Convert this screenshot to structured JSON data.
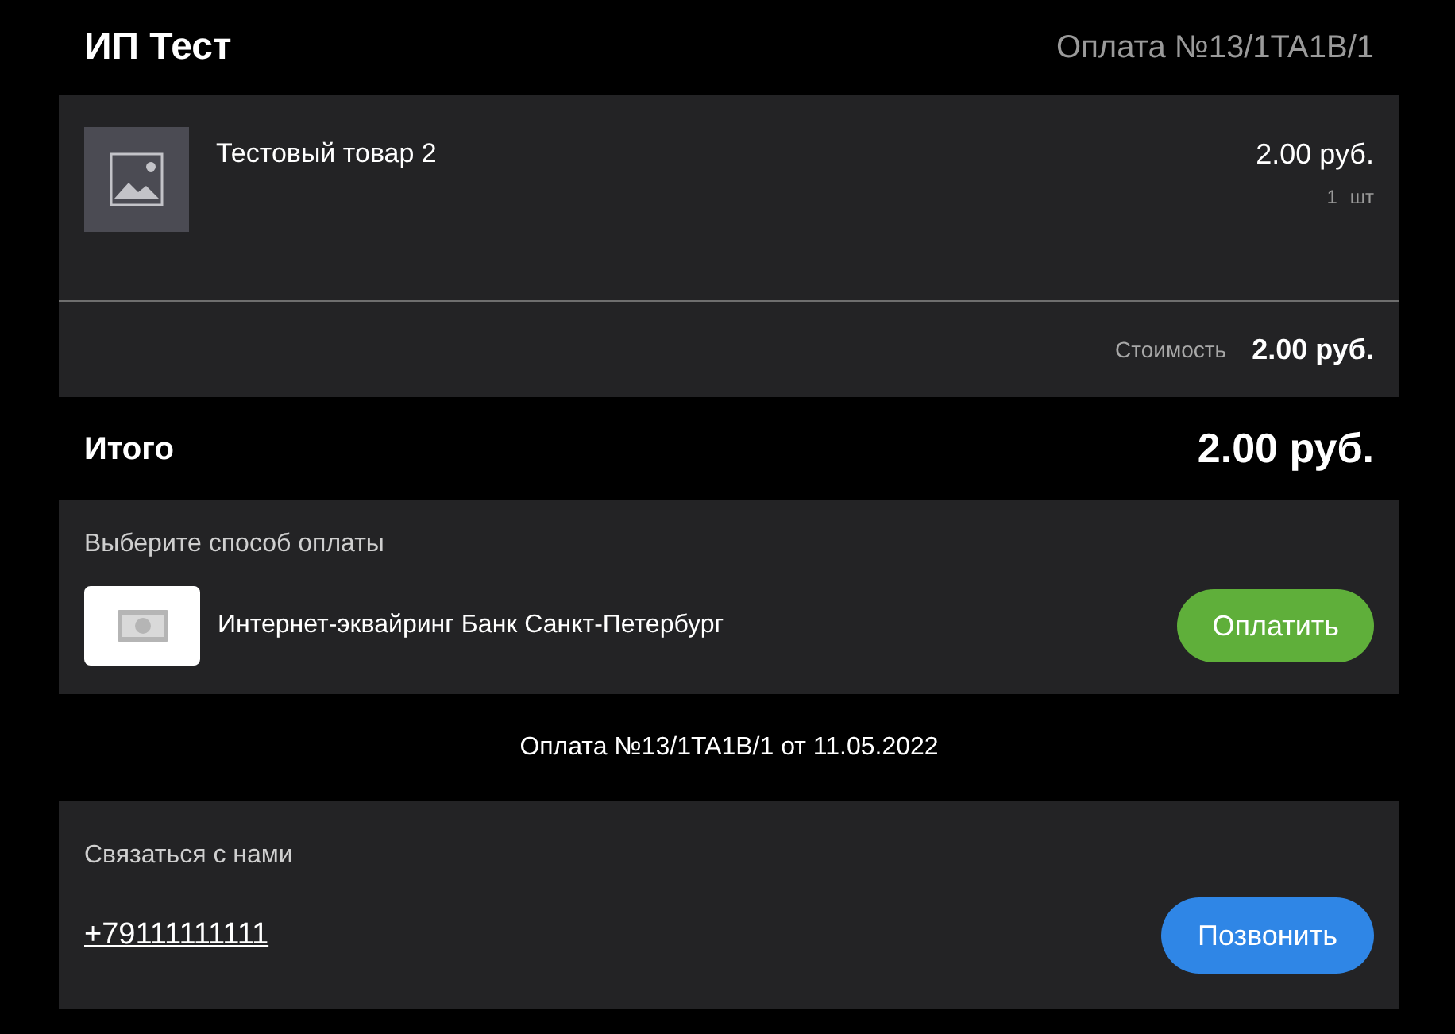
{
  "header": {
    "merchant": "ИП Тест",
    "order": "Оплата №13/1TA1B/1"
  },
  "items": [
    {
      "name": "Тестовый товар 2",
      "price": "2.00 руб.",
      "qty": "1",
      "unit": "шт"
    }
  ],
  "subtotal": {
    "label": "Стоимость",
    "value": "2.00 руб."
  },
  "total": {
    "label": "Итого",
    "value": "2.00 руб."
  },
  "payment": {
    "title": "Выберите способ оплаты",
    "method": "Интернет-эквайринг Банк Санкт-Петербург",
    "button": "Оплатить"
  },
  "order_line": "Оплата №13/1TA1B/1 от 11.05.2022",
  "contact": {
    "title": "Связаться с нами",
    "phone": "+79111111111",
    "button": "Позвонить"
  }
}
